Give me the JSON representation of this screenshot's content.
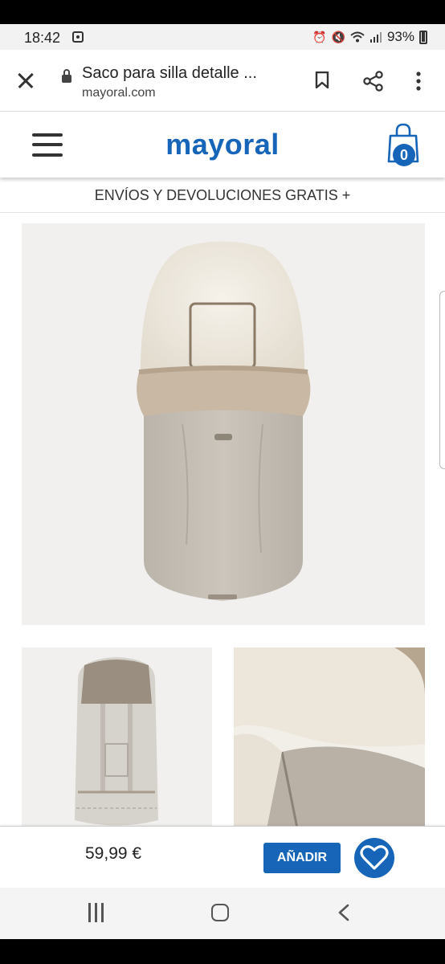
{
  "status_bar": {
    "time": "18:42",
    "battery": "93%",
    "icons": [
      "alarm-icon",
      "mute-icon",
      "wifi-icon",
      "signal-icon",
      "battery-icon"
    ]
  },
  "browser": {
    "title": "Saco para silla detalle ...",
    "url": "mayoral.com"
  },
  "site": {
    "logo": "mayoral",
    "brand_color": "#1765b8",
    "cart_count": "0",
    "banner": "ENVÍOS Y DEVOLUCIONES GRATIS +"
  },
  "product": {
    "price": "59,99 €",
    "add_label": "AÑADIR",
    "images": [
      "main-product-photo",
      "thumb-back-view",
      "thumb-detail-view"
    ]
  },
  "colors": {
    "fur": "#ece7dd",
    "body": "#c6bfb6",
    "accent": "#1765b8"
  }
}
